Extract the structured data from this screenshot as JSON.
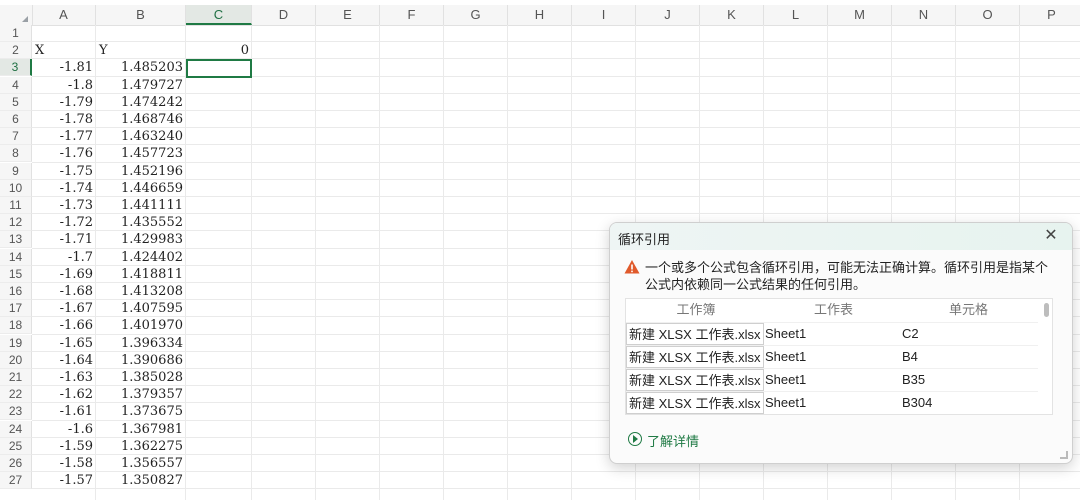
{
  "sheet": {
    "columns": [
      "A",
      "B",
      "C",
      "D",
      "E",
      "F",
      "G",
      "H",
      "I",
      "J",
      "K",
      "L",
      "M",
      "N",
      "O",
      "P"
    ],
    "active_column": "C",
    "active_row": "3",
    "rows": [
      {
        "n": "1",
        "a": "",
        "b": "",
        "c": ""
      },
      {
        "n": "2",
        "a": "X",
        "b": "Y",
        "c": "0"
      },
      {
        "n": "3",
        "a": "-1.81",
        "b": "1.485203",
        "c": ""
      },
      {
        "n": "4",
        "a": "-1.8",
        "b": "1.479727",
        "c": ""
      },
      {
        "n": "5",
        "a": "-1.79",
        "b": "1.474242",
        "c": ""
      },
      {
        "n": "6",
        "a": "-1.78",
        "b": "1.468746",
        "c": ""
      },
      {
        "n": "7",
        "a": "-1.77",
        "b": "1.463240",
        "c": ""
      },
      {
        "n": "8",
        "a": "-1.76",
        "b": "1.457723",
        "c": ""
      },
      {
        "n": "9",
        "a": "-1.75",
        "b": "1.452196",
        "c": ""
      },
      {
        "n": "10",
        "a": "-1.74",
        "b": "1.446659",
        "c": ""
      },
      {
        "n": "11",
        "a": "-1.73",
        "b": "1.441111",
        "c": ""
      },
      {
        "n": "12",
        "a": "-1.72",
        "b": "1.435552",
        "c": ""
      },
      {
        "n": "13",
        "a": "-1.71",
        "b": "1.429983",
        "c": ""
      },
      {
        "n": "14",
        "a": "-1.7",
        "b": "1.424402",
        "c": ""
      },
      {
        "n": "15",
        "a": "-1.69",
        "b": "1.418811",
        "c": ""
      },
      {
        "n": "16",
        "a": "-1.68",
        "b": "1.413208",
        "c": ""
      },
      {
        "n": "17",
        "a": "-1.67",
        "b": "1.407595",
        "c": ""
      },
      {
        "n": "18",
        "a": "-1.66",
        "b": "1.401970",
        "c": ""
      },
      {
        "n": "19",
        "a": "-1.65",
        "b": "1.396334",
        "c": ""
      },
      {
        "n": "20",
        "a": "-1.64",
        "b": "1.390686",
        "c": ""
      },
      {
        "n": "21",
        "a": "-1.63",
        "b": "1.385028",
        "c": ""
      },
      {
        "n": "22",
        "a": "-1.62",
        "b": "1.379357",
        "c": ""
      },
      {
        "n": "23",
        "a": "-1.61",
        "b": "1.373675",
        "c": ""
      },
      {
        "n": "24",
        "a": "-1.6",
        "b": "1.367981",
        "c": ""
      },
      {
        "n": "25",
        "a": "-1.59",
        "b": "1.362275",
        "c": ""
      },
      {
        "n": "26",
        "a": "-1.58",
        "b": "1.356557",
        "c": ""
      },
      {
        "n": "27",
        "a": "-1.57",
        "b": "1.350827",
        "c": ""
      }
    ]
  },
  "dialog": {
    "title": "循环引用",
    "close_icon": "close-icon",
    "message": "一个或多个公式包含循环引用，可能无法正确计算。循环引用是指某个公式内依赖同一公式结果的任何引用。",
    "table_headers": [
      "工作簿",
      "工作表",
      "单元格"
    ],
    "table_rows": [
      {
        "workbook": "新建 XLSX 工作表.xlsx",
        "sheet": "Sheet1",
        "cell": "C2"
      },
      {
        "workbook": "新建 XLSX 工作表.xlsx",
        "sheet": "Sheet1",
        "cell": "B4"
      },
      {
        "workbook": "新建 XLSX 工作表.xlsx",
        "sheet": "Sheet1",
        "cell": "B35"
      },
      {
        "workbook": "新建 XLSX 工作表.xlsx",
        "sheet": "Sheet1",
        "cell": "B304"
      }
    ],
    "learn_more": "了解详情",
    "accent_color": "#1f7a44",
    "warning_color": "#e05a2b"
  }
}
